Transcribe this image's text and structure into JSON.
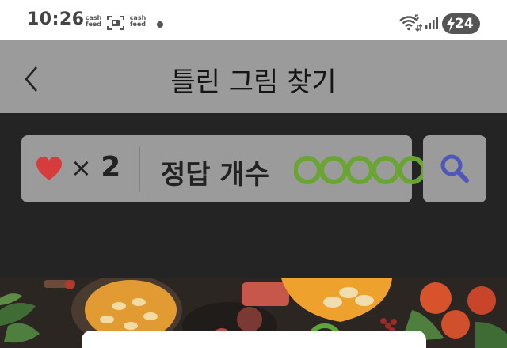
{
  "status_bar": {
    "time": "10:26",
    "notif_app_1": "cash feed",
    "notif_app_1_top": "cash",
    "notif_app_1_bottom": "feed",
    "notif_app_2_top": "cash",
    "notif_app_2_bottom": "feed",
    "network_label": "5",
    "battery_level": "24",
    "icons": [
      "scan-icon",
      "dot-icon",
      "wifi-icon",
      "signal-icon",
      "battery-icon"
    ]
  },
  "header": {
    "title": "틀린 그림 찾기",
    "back_icon": "chevron-left-icon"
  },
  "game_status": {
    "lives_symbol": "×",
    "lives_count": "2",
    "answers_label": "정답 개수",
    "answers_total": 5,
    "answers_found": 0,
    "colors": {
      "heart": "#d63c3c",
      "answer_circle": "#6aa534",
      "panel": "#9b9b9b",
      "background": "#242424",
      "magnifier": "#4f57b8"
    }
  },
  "hint_button": {
    "icon": "magnifier-icon"
  }
}
